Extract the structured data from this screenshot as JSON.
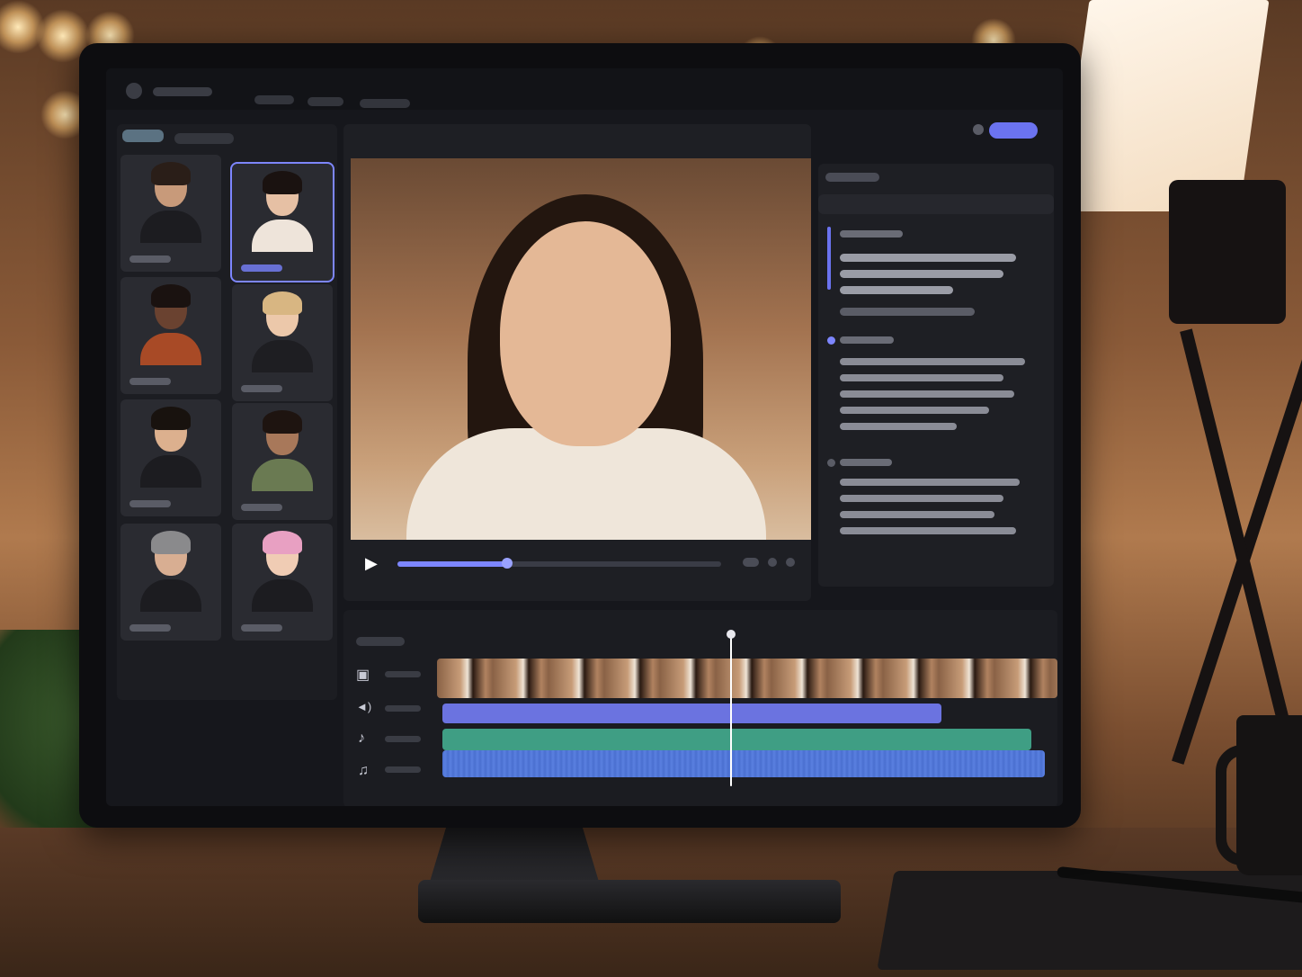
{
  "editor": {
    "controls": {
      "play_icon": "play-icon"
    },
    "timeline": {
      "tracks": [
        {
          "icon": "video-camera-icon",
          "glyph": "▣"
        },
        {
          "icon": "speaker-icon",
          "glyph": "◄)"
        },
        {
          "icon": "music-note-icon",
          "glyph": "♪"
        },
        {
          "icon": "double-music-note-icon",
          "glyph": "♫"
        }
      ]
    },
    "playback_progress": 0.34,
    "colors": {
      "accent": "#7d86ff",
      "voice_track": "#6b73e0",
      "music_track": "#3f9e84",
      "audio_track": "#4a6fd0"
    }
  }
}
